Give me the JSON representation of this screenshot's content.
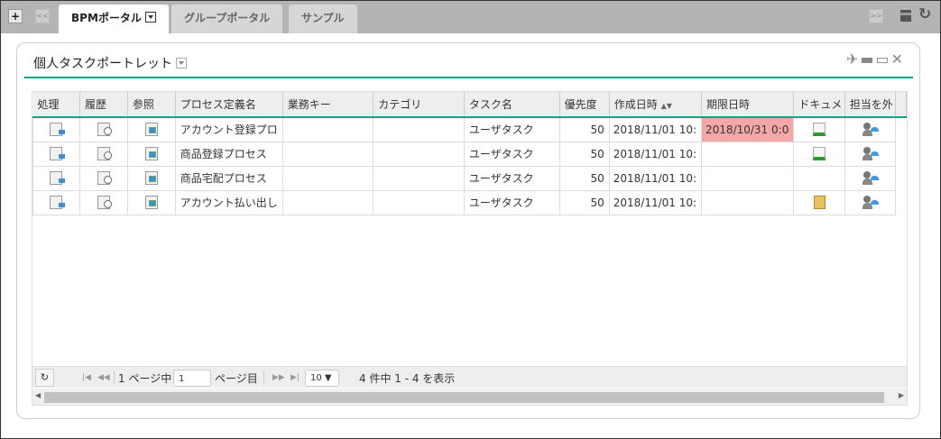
{
  "topbar": {
    "add_label": "+",
    "prev_label": "<<",
    "next_label": ">>",
    "tabs": [
      {
        "label": "BPMポータル",
        "active": true
      },
      {
        "label": "グループポータル"
      },
      {
        "label": "サンプル"
      }
    ]
  },
  "portlet": {
    "title": "個人タスクポートレット"
  },
  "grid": {
    "columns": [
      "処理",
      "履歴",
      "参照",
      "プロセス定義名",
      "業務キー",
      "カテゴリ",
      "タスク名",
      "優先度",
      "作成日時",
      "期限日時",
      "ドキュメ",
      "担当を外"
    ],
    "sort_column": "作成日時",
    "rows": [
      {
        "process": "アカウント登録プロ",
        "key": "",
        "category": "",
        "task": "ユーザタスク",
        "priority": "50",
        "created": "2018/11/01 10:",
        "due": "2018/10/31 0:0",
        "doc": "sheet"
      },
      {
        "process": "商品登録プロセス",
        "key": "",
        "category": "",
        "task": "ユーザタスク",
        "priority": "50",
        "created": "2018/11/01 10:",
        "due": "",
        "doc": "sheet"
      },
      {
        "process": "商品宅配プロセス",
        "key": "",
        "category": "",
        "task": "ユーザタスク",
        "priority": "50",
        "created": "2018/11/01 10:",
        "due": "",
        "doc": ""
      },
      {
        "process": "アカウント払い出し",
        "key": "",
        "category": "",
        "task": "ユーザタスク",
        "priority": "50",
        "created": "2018/11/01 10:",
        "due": "",
        "doc": "folder"
      }
    ],
    "overdue_color": "#f4a7a7"
  },
  "pager": {
    "refresh": "↻",
    "page_prefix": "1 ページ中",
    "page_value": "1",
    "page_suffix": "ページ目",
    "page_size": "10 ▼",
    "summary": "4 件中 1 - 4 を表示"
  }
}
